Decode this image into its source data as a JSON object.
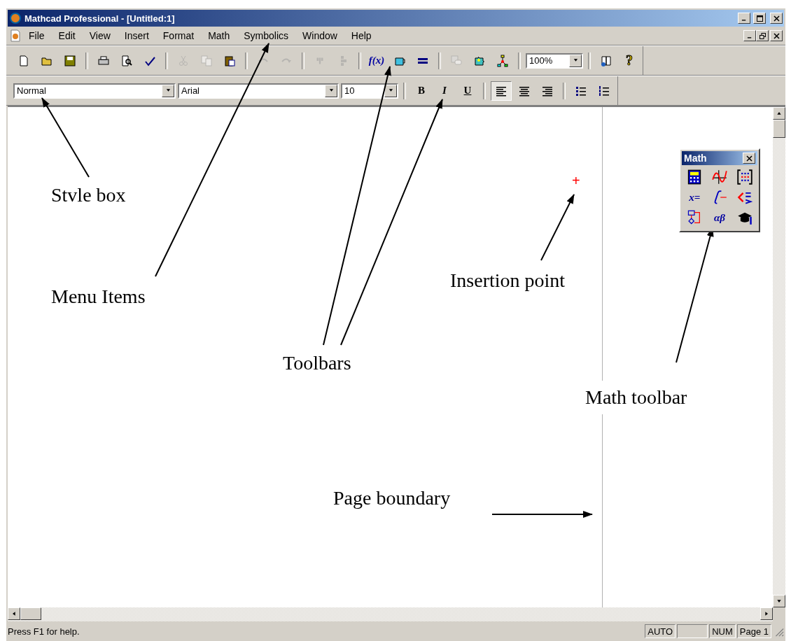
{
  "window": {
    "title": "Mathcad Professional - [Untitled:1]"
  },
  "menu": [
    "File",
    "Edit",
    "View",
    "Insert",
    "Format",
    "Math",
    "Symbolics",
    "Window",
    "Help"
  ],
  "standard_toolbar": {
    "groups": [
      [
        {
          "kind": "new",
          "disabled": false
        },
        {
          "kind": "open",
          "disabled": false
        },
        {
          "kind": "save",
          "disabled": false
        }
      ],
      [
        {
          "kind": "print",
          "disabled": false
        },
        {
          "kind": "preview",
          "disabled": false
        },
        {
          "kind": "spell",
          "disabled": false
        }
      ],
      [
        {
          "kind": "cut",
          "disabled": true
        },
        {
          "kind": "copy",
          "disabled": true
        },
        {
          "kind": "paste",
          "disabled": false
        }
      ],
      [
        {
          "kind": "undo",
          "disabled": true
        },
        {
          "kind": "redo",
          "disabled": true
        }
      ],
      [
        {
          "kind": "align_across",
          "disabled": true
        },
        {
          "kind": "align_down",
          "disabled": true
        }
      ],
      [
        {
          "kind": "function",
          "label": "f(x)",
          "disabled": false
        },
        {
          "kind": "unit",
          "disabled": false
        },
        {
          "kind": "calculate",
          "disabled": false
        }
      ],
      [
        {
          "kind": "component",
          "disabled": true
        },
        {
          "kind": "puzzle",
          "disabled": false
        },
        {
          "kind": "network",
          "disabled": false
        }
      ]
    ],
    "zoom": "100%",
    "tail": [
      {
        "kind": "resources",
        "disabled": false
      },
      {
        "kind": "help",
        "label": "?",
        "disabled": false
      }
    ]
  },
  "formatting_toolbar": {
    "style": "Normal",
    "font": "Arial",
    "size": "10",
    "emphasis": [
      {
        "kind": "bold",
        "label": "B"
      },
      {
        "kind": "italic",
        "label": "I"
      },
      {
        "kind": "underline",
        "label": "U"
      }
    ],
    "alignment": [
      {
        "kind": "left",
        "selected": true
      },
      {
        "kind": "center",
        "selected": false
      },
      {
        "kind": "right",
        "selected": false
      }
    ],
    "lists": [
      {
        "kind": "bullets"
      },
      {
        "kind": "numbers"
      }
    ]
  },
  "worksheet": {
    "insertion_marker": "+",
    "annotations": [
      {
        "text": "Stvle box"
      },
      {
        "text": "Menu Items"
      },
      {
        "text": "Insertion point"
      },
      {
        "text": "Toolbars"
      },
      {
        "text": "Math toolbar"
      },
      {
        "text": "Page boundary"
      }
    ]
  },
  "math_toolbar": {
    "title": "Math",
    "buttons": [
      {
        "kind": "calculator"
      },
      {
        "kind": "graph"
      },
      {
        "kind": "matrix"
      },
      {
        "kind": "evaluation",
        "label": "x="
      },
      {
        "kind": "calculus"
      },
      {
        "kind": "boolean"
      },
      {
        "kind": "programming"
      },
      {
        "kind": "greek",
        "label": "αβ"
      },
      {
        "kind": "symbolic"
      }
    ]
  },
  "status_bar": {
    "message": "Press F1 for help.",
    "panels": [
      "AUTO",
      "NUM",
      "Page 1"
    ]
  }
}
